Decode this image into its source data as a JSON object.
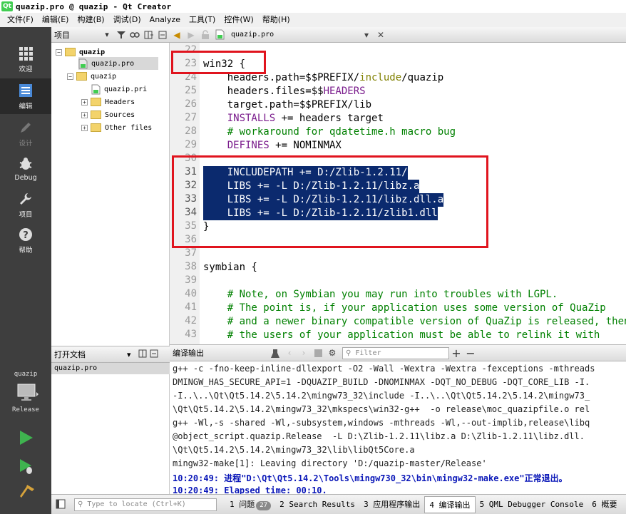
{
  "window": {
    "title": "quazip.pro @ quazip - Qt Creator",
    "logo": "Qt"
  },
  "menu": [
    "文件(F)",
    "编辑(E)",
    "构建(B)",
    "调试(D)",
    "Analyze",
    "工具(T)",
    "控件(W)",
    "帮助(H)"
  ],
  "modes": [
    {
      "label": "欢迎",
      "icon": "grid-icon"
    },
    {
      "label": "编辑",
      "icon": "edit-document-icon"
    },
    {
      "label": "设计",
      "icon": "pencil-icon"
    },
    {
      "label": "Debug",
      "icon": "bug-icon"
    },
    {
      "label": "项目",
      "icon": "wrench-icon"
    },
    {
      "label": "帮助",
      "icon": "help-icon"
    }
  ],
  "kit": {
    "project": "quazip",
    "config": "Release"
  },
  "project_panel": {
    "combo_label": "项目",
    "tree": [
      {
        "label": "quazip",
        "type": "project"
      },
      {
        "label": "quazip.pro",
        "type": "pro-file"
      },
      {
        "label": "quazip",
        "type": "subproject"
      },
      {
        "label": "quazip.pri",
        "type": "file"
      },
      {
        "label": "Headers",
        "type": "folder"
      },
      {
        "label": "Sources",
        "type": "folder"
      },
      {
        "label": "Other files",
        "type": "folder"
      }
    ]
  },
  "editor": {
    "file_name": "quazip.pro",
    "lines": [
      {
        "n": "22",
        "parts": []
      },
      {
        "n": "23",
        "parts": [
          [
            "",
            "win32 {"
          ]
        ]
      },
      {
        "n": "24",
        "parts": [
          [
            "",
            "    headers.path=$$PREFIX/"
          ],
          [
            "mk",
            "include"
          ],
          [
            "",
            "/quazip"
          ]
        ]
      },
      {
        "n": "25",
        "parts": [
          [
            "",
            "    headers.files=$$"
          ],
          [
            "kw",
            "HEADERS"
          ]
        ]
      },
      {
        "n": "26",
        "parts": [
          [
            "",
            "    target.path=$$PREFIX/lib"
          ]
        ]
      },
      {
        "n": "27",
        "parts": [
          [
            "kw",
            "    INSTALLS"
          ],
          [
            "",
            " += headers target"
          ]
        ]
      },
      {
        "n": "28",
        "parts": [
          [
            "cm",
            "    # workaround for qdatetime.h macro bug"
          ]
        ]
      },
      {
        "n": "29",
        "parts": [
          [
            "kw",
            "    DEFINES"
          ],
          [
            "",
            " += NOMINMAX"
          ]
        ]
      },
      {
        "n": "30",
        "parts": []
      },
      {
        "n": "31",
        "sel": true,
        "parts": [
          [
            "",
            "    INCLUDEPATH += D:/Zlib-1.2.11/"
          ]
        ]
      },
      {
        "n": "32",
        "sel": true,
        "parts": [
          [
            "",
            "    LIBS += -L D:/Zlib-1.2.11/libz.a"
          ]
        ]
      },
      {
        "n": "33",
        "sel": true,
        "parts": [
          [
            "",
            "    LIBS += -L D:/Zlib-1.2.11/libz.dll.a"
          ]
        ]
      },
      {
        "n": "34",
        "sel": true,
        "parts": [
          [
            "",
            "    LIBS += -L D:/Zlib-1.2.11/zlib1.dll"
          ]
        ]
      },
      {
        "n": "35",
        "parts": [
          [
            "",
            "}"
          ]
        ]
      },
      {
        "n": "36",
        "parts": []
      },
      {
        "n": "37",
        "parts": []
      },
      {
        "n": "38",
        "parts": [
          [
            "",
            "symbian {"
          ]
        ]
      },
      {
        "n": "39",
        "parts": []
      },
      {
        "n": "40",
        "parts": [
          [
            "cm",
            "    # Note, on Symbian you may run into troubles with LGPL."
          ]
        ]
      },
      {
        "n": "41",
        "parts": [
          [
            "cm",
            "    # The point is, if your application uses some version of QuaZip"
          ]
        ]
      },
      {
        "n": "42",
        "parts": [
          [
            "cm",
            "    # and a newer binary compatible version of QuaZip is released, then"
          ]
        ]
      },
      {
        "n": "43",
        "parts": [
          [
            "cm",
            "    # the users of your application must be able to relink it with"
          ]
        ]
      }
    ]
  },
  "open_docs": {
    "title": "打开文档",
    "items": [
      "quazip.pro"
    ]
  },
  "output": {
    "title": "编译输出",
    "filter_placeholder": "Filter",
    "lines": [
      {
        "t": "g++ -c -fno-keep-inline-dllexport -O2 -Wall -Wextra -Wextra -fexceptions -mthreads",
        "blue": false
      },
      {
        "t": "DMINGW_HAS_SECURE_API=1 -DQUAZIP_BUILD -DNOMINMAX -DQT_NO_DEBUG -DQT_CORE_LIB -I.",
        "blue": false
      },
      {
        "t": "-I..\\..\\Qt\\Qt5.14.2\\5.14.2\\mingw73_32\\include -I..\\..\\Qt\\Qt5.14.2\\5.14.2\\mingw73_",
        "blue": false
      },
      {
        "t": "\\Qt\\Qt5.14.2\\5.14.2\\mingw73_32\\mkspecs\\win32-g++  -o release\\moc_quazipfile.o rel",
        "blue": false
      },
      {
        "t": "g++ -Wl,-s -shared -Wl,-subsystem,windows -mthreads -Wl,--out-implib,release\\libq",
        "blue": false
      },
      {
        "t": "@object_script.quazip.Release  -L D:\\Zlib-1.2.11\\libz.a D:\\Zlib-1.2.11\\libz.dll.",
        "blue": false
      },
      {
        "t": "\\Qt\\Qt5.14.2\\5.14.2\\mingw73_32\\lib\\libQt5Core.a",
        "blue": false
      },
      {
        "t": "mingw32-make[1]: Leaving directory 'D:/quazip-master/Release'",
        "blue": false
      },
      {
        "t": "10:20:49: 进程\"D:\\Qt\\Qt5.14.2\\Tools\\mingw730_32\\bin\\mingw32-make.exe\"正常退出。",
        "blue": true
      },
      {
        "t": "10:20:49: Elapsed time: 00:10.",
        "blue": true
      }
    ]
  },
  "statusbar": {
    "locate_placeholder": "Type to locate (Ctrl+K)",
    "panes": [
      {
        "label": "1 问题",
        "badge": "27"
      },
      {
        "label": "2 Search Results"
      },
      {
        "label": "3 应用程序输出"
      },
      {
        "label": "4 编译输出",
        "active": true
      },
      {
        "label": "5 QML Debugger Console"
      },
      {
        "label": "6 概要"
      }
    ]
  },
  "colors": {
    "selection": "#0b2a6e",
    "annotation_box": "#e0141e",
    "keyword": "#7a1c8c",
    "comment": "#008000",
    "sidebar": "#3e3e3e"
  }
}
